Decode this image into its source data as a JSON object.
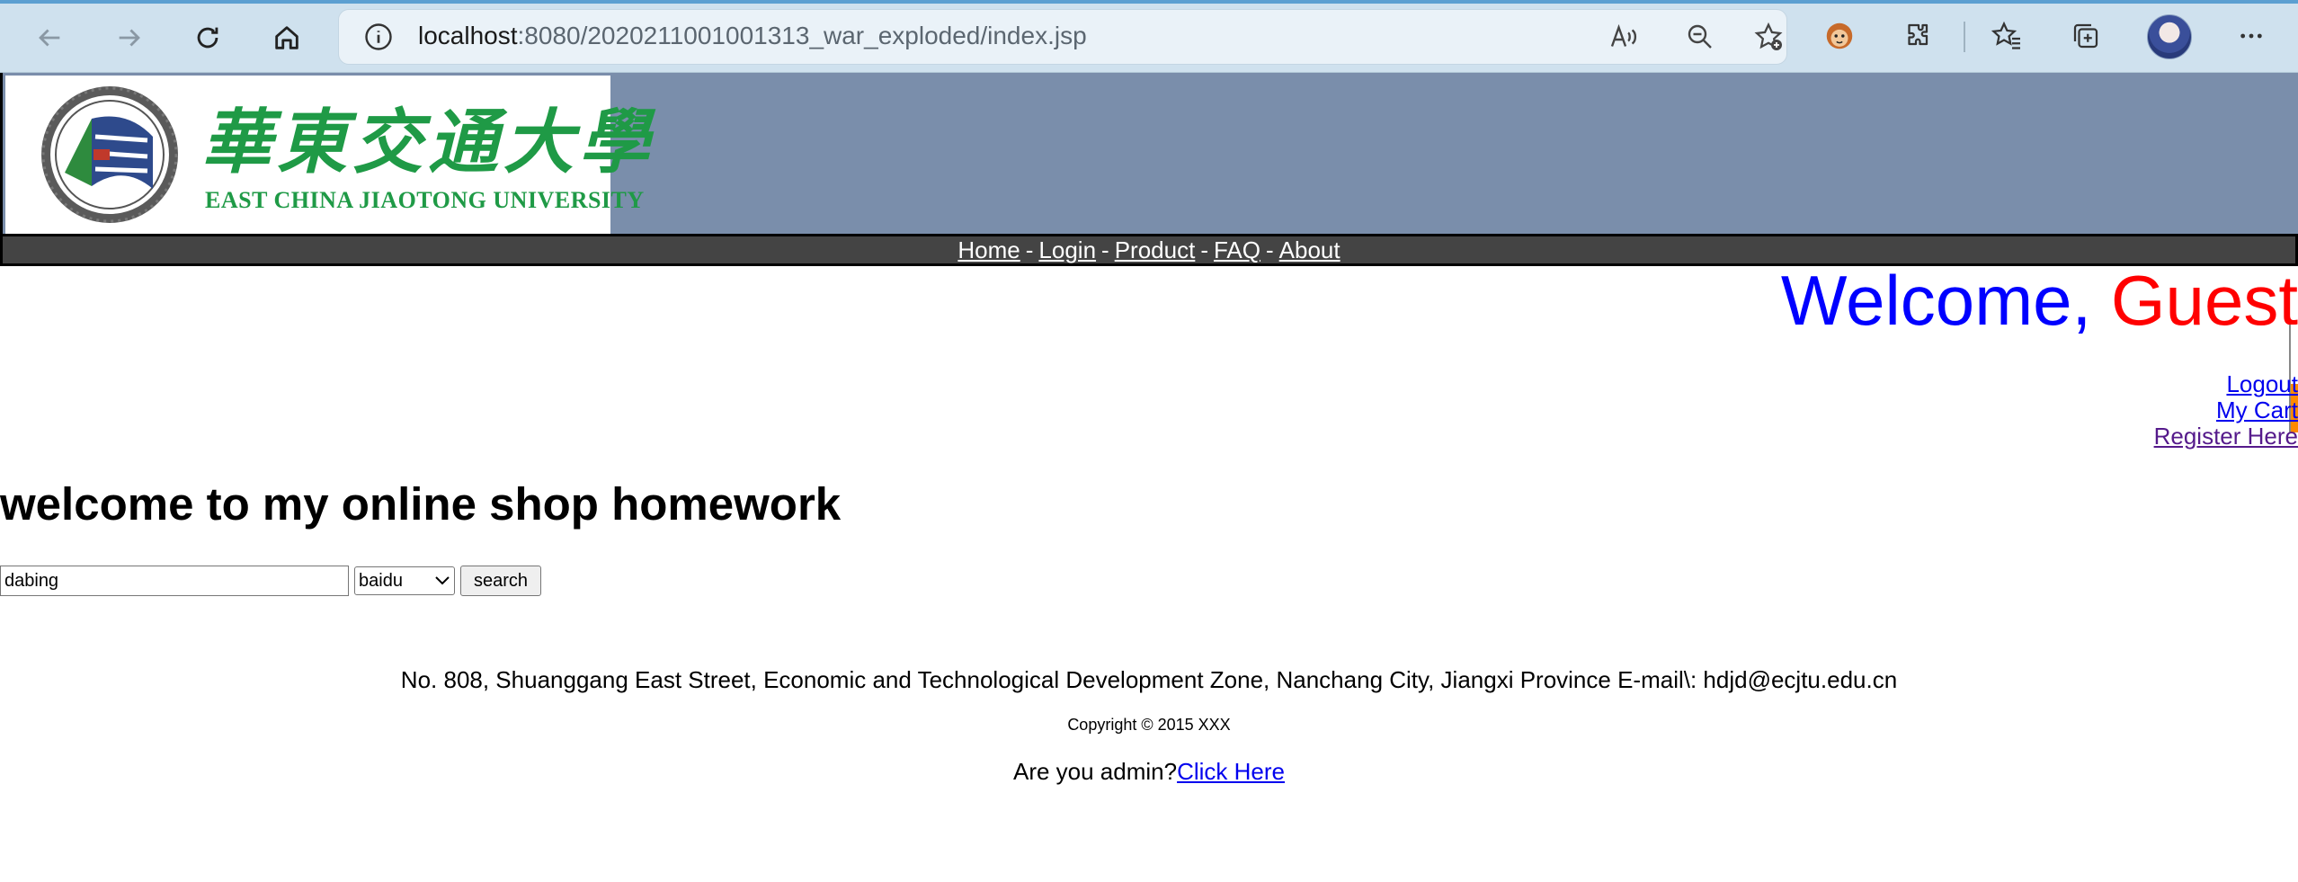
{
  "browser": {
    "url_host": "localhost",
    "url_path": ":8080/2020211001001313_war_exploded/index.jsp"
  },
  "header": {
    "logo_cn": "華東交通大學",
    "logo_en": "EAST CHINA JIAOTONG UNIVERSITY"
  },
  "nav": {
    "items": [
      "Home",
      "Login",
      "Product",
      "FAQ",
      "About"
    ],
    "separator": "-"
  },
  "welcome": {
    "prefix": "Welcome, ",
    "name": "Guest"
  },
  "user_links": {
    "logout": "Logout",
    "cart": "My Cart",
    "register": "Register Here"
  },
  "main": {
    "title": "welcome to my online shop homework",
    "search_value": "dabing",
    "engine_selected": "baidu",
    "search_button": "search"
  },
  "footer": {
    "address": "No. 808, Shuanggang East Street, Economic and Technological Development Zone, Nanchang City, Jiangxi Province E-mail\\: hdjd@ecjtu.edu.cn",
    "copyright": "Copyright © 2015 XXX",
    "admin_prompt": "Are you admin?",
    "admin_link": "Click Here"
  },
  "colors": {
    "header_bg": "#7a8eab",
    "navbar_bg": "#444444",
    "welcome_color": "#0000ff",
    "guest_color": "#ff0000",
    "logo_green": "#1f9a46"
  }
}
